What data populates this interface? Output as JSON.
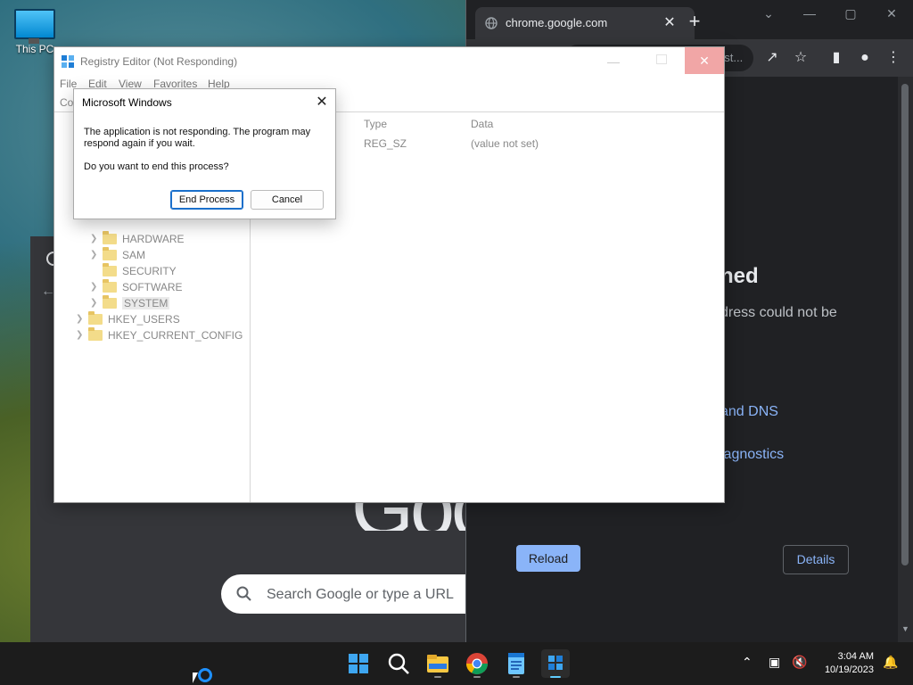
{
  "desktop": {
    "icon_label": "This PC"
  },
  "background_browser": {
    "search_placeholder": "Search Google or type a URL",
    "logo_fragment": "Goo"
  },
  "chrome": {
    "tab_title": "chrome.google.com",
    "omnibox_fragment": "bst...",
    "error_title_fragment": "hed",
    "error_desc_fragment": "dress could not be",
    "link1_fragment": "and DNS",
    "link2_fragment": "iagnostics",
    "reload_label": "Reload",
    "details_label": "Details",
    "accent": "#8ab4f8"
  },
  "regedit": {
    "title": "Registry Editor (Not Responding)",
    "menu": [
      "File",
      "Edit",
      "View",
      "Favorites",
      "Help"
    ],
    "address_label_fragment": "Co",
    "tree": [
      {
        "label": "HARDWARE",
        "expandable": true
      },
      {
        "label": "SAM",
        "expandable": true
      },
      {
        "label": "SECURITY",
        "expandable": false
      },
      {
        "label": "SOFTWARE",
        "expandable": true
      },
      {
        "label": "SYSTEM",
        "expandable": true,
        "selected": true
      },
      {
        "label": "HKEY_USERS",
        "expandable": true
      },
      {
        "label": "HKEY_CURRENT_CONFIG",
        "expandable": true
      }
    ],
    "columns": {
      "type": "Type",
      "data": "Data"
    },
    "row": {
      "type": "REG_SZ",
      "data": "(value not set)"
    }
  },
  "dialog": {
    "title": "Microsoft Windows",
    "message": "The application is not responding. The program may respond again if you wait.",
    "question": "Do you want to end this process?",
    "end_label": "End Process",
    "cancel_label": "Cancel"
  },
  "taskbar": {
    "time": "3:04 AM",
    "date": "10/19/2023",
    "apps": [
      "start-icon",
      "search-icon",
      "file-explorer-icon",
      "chrome-icon",
      "notepad-icon",
      "regedit-icon"
    ]
  }
}
